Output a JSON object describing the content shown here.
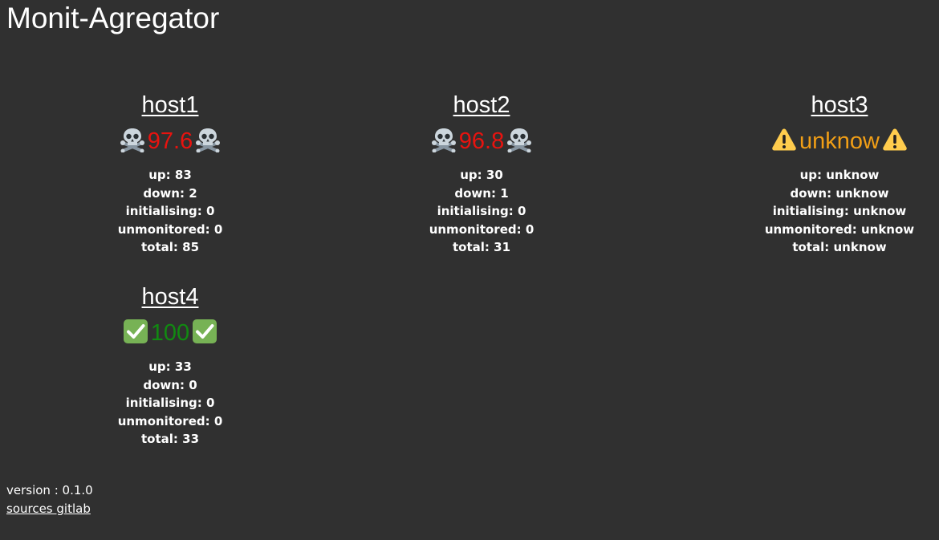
{
  "app": {
    "title": "Monit-Agregator"
  },
  "colors": {
    "background": "#303030",
    "text": "#ffffff",
    "critical": "#e8130f",
    "warning": "#f29f16",
    "ok": "#118a11"
  },
  "labels": {
    "up": "up:",
    "down": "down:",
    "initialising": "initialising:",
    "unmonitored": "unmonitored:",
    "total": "total:"
  },
  "hosts": [
    {
      "name": "host1",
      "score": "97.6",
      "status": "critical",
      "icon": "skull-crossbones-icon",
      "up": "83",
      "down": "2",
      "initialising": "0",
      "unmonitored": "0",
      "total": "85"
    },
    {
      "name": "host2",
      "score": "96.8",
      "status": "critical",
      "icon": "skull-crossbones-icon",
      "up": "30",
      "down": "1",
      "initialising": "0",
      "unmonitored": "0",
      "total": "31"
    },
    {
      "name": "host3",
      "score": "unknow",
      "status": "warning",
      "icon": "warning-icon",
      "up": "unknow",
      "down": "unknow",
      "initialising": "unknow",
      "unmonitored": "unknow",
      "total": "unknow"
    },
    {
      "name": "host4",
      "score": "100",
      "status": "ok",
      "icon": "check-mark-icon",
      "up": "33",
      "down": "0",
      "initialising": "0",
      "unmonitored": "0",
      "total": "33"
    }
  ],
  "footer": {
    "version_text": "version : 0.1.0",
    "sources_link": "sources gitlab"
  }
}
